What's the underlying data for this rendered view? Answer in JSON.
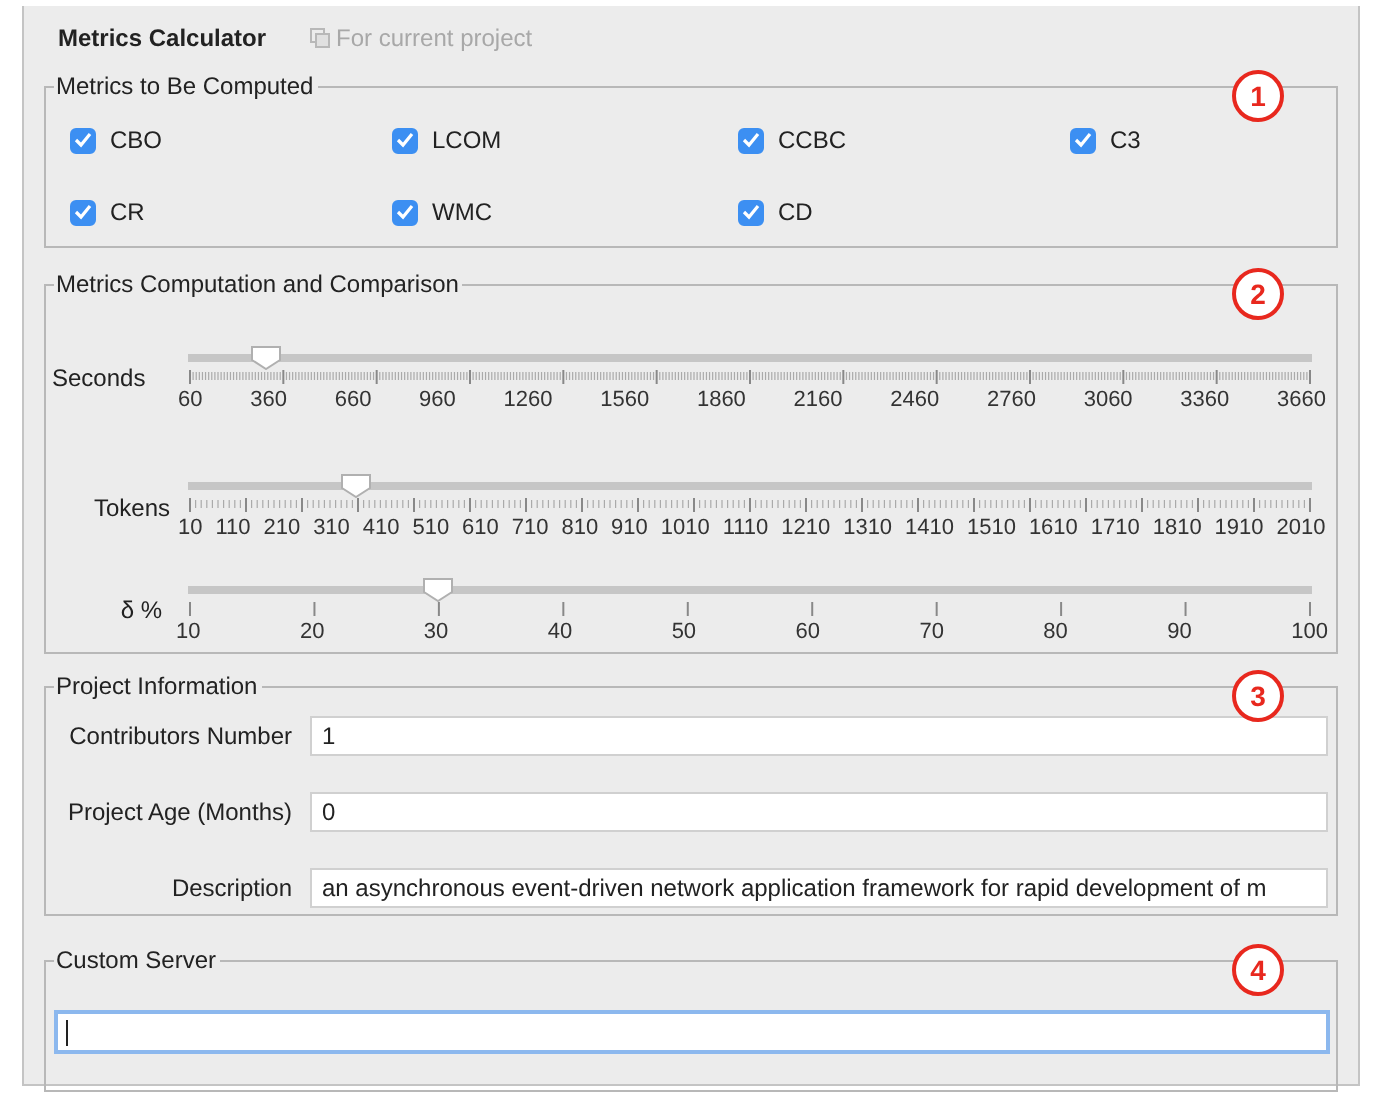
{
  "header": {
    "title": "Metrics Calculator",
    "scope": "For current project"
  },
  "metrics_group": {
    "title": "Metrics to Be Computed",
    "badge": "1",
    "checkboxes": [
      {
        "label": "CBO",
        "checked": true
      },
      {
        "label": "LCOM",
        "checked": true
      },
      {
        "label": "CCBC",
        "checked": true
      },
      {
        "label": "C3",
        "checked": true
      },
      {
        "label": "CR",
        "checked": true
      },
      {
        "label": "WMC",
        "checked": true
      },
      {
        "label": "CD",
        "checked": true
      }
    ]
  },
  "comparison_group": {
    "title": "Metrics Computation and Comparison",
    "badge": "2",
    "sliders": [
      {
        "label": "Seconds",
        "level": 0.07,
        "kind": "fine",
        "ticks": [
          "60",
          "360",
          "660",
          "960",
          "1260",
          "1560",
          "1860",
          "2160",
          "2460",
          "2760",
          "3060",
          "3360",
          "3660"
        ]
      },
      {
        "label": "Tokens",
        "level": 0.15,
        "kind": "medium",
        "ticks": [
          "10",
          "110",
          "210",
          "310",
          "410",
          "510",
          "610",
          "710",
          "810",
          "910",
          "1010",
          "1110",
          "1210",
          "1310",
          "1410",
          "1510",
          "1610",
          "1710",
          "1810",
          "1910",
          "2010"
        ]
      },
      {
        "label": "δ %",
        "level": 0.222,
        "kind": "plain",
        "ticks": [
          "10",
          "20",
          "30",
          "40",
          "50",
          "60",
          "70",
          "80",
          "90",
          "100"
        ]
      }
    ]
  },
  "project_group": {
    "title": "Project Information",
    "badge": "3",
    "fields": [
      {
        "label": "Contributors Number",
        "value": "1"
      },
      {
        "label": "Project Age (Months)",
        "value": "0"
      },
      {
        "label": "Description",
        "value": "an asynchronous event-driven network application framework for rapid development of m"
      }
    ]
  },
  "server_group": {
    "title": "Custom Server",
    "badge": "4",
    "field": {
      "focused": true
    }
  }
}
